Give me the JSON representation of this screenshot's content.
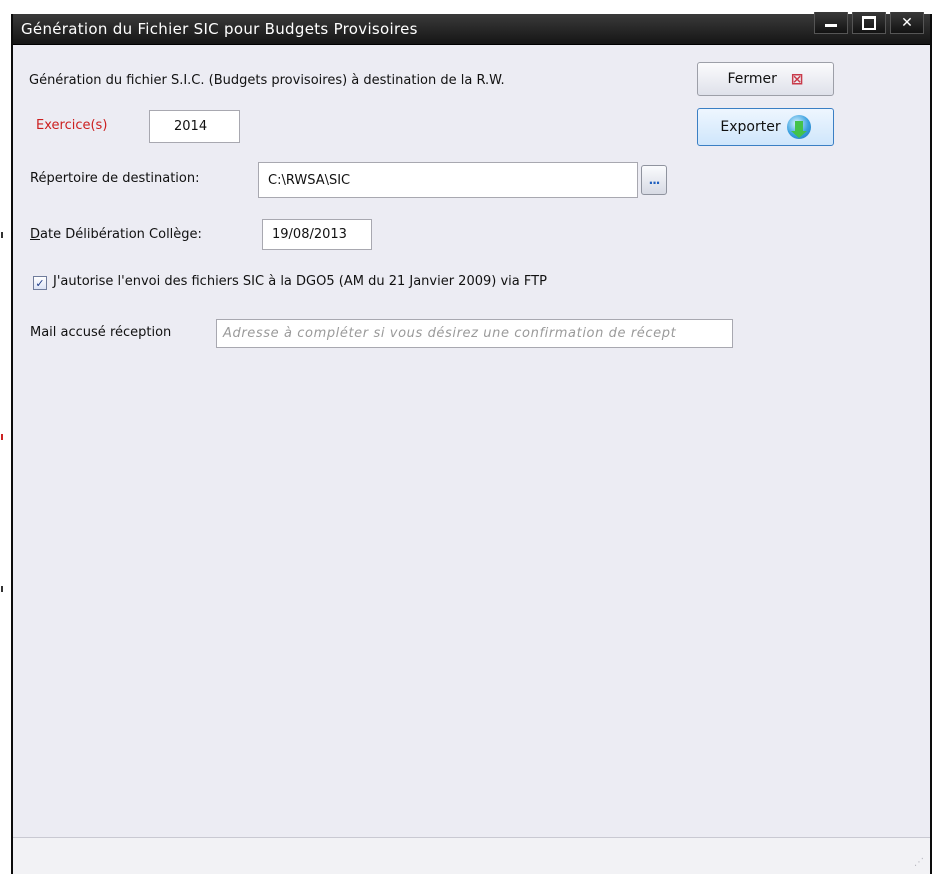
{
  "window": {
    "title": "Génération du Fichier SIC pour Budgets Provisoires",
    "controls": {
      "minimize": "minimize-icon",
      "maximize": "maximize-icon",
      "close": "close-icon"
    }
  },
  "form": {
    "description": "Génération du fichier S.I.C. (Budgets provisoires) à destination de la R.W.",
    "exercise_label": "Exercice(s)",
    "exercise_value": "2014",
    "directory_label": "Répertoire de destination:",
    "directory_value": "C:\\RWSA\\SIC",
    "browse_label": "...",
    "date_label_mnemonic": "D",
    "date_label_rest": "ate Délibération Collège:",
    "date_value": "19/08/2013",
    "ftp_checkbox_label": "J'autorise l'envoi des fichiers SIC à la DGO5 (AM du 21 Janvier 2009) via FTP",
    "ftp_checked": true,
    "mail_label": "Mail accusé réception",
    "mail_placeholder": "Adresse à compléter si vous désirez une confirmation de récept"
  },
  "buttons": {
    "close_label": "Fermer",
    "close_icon": "close-x-icon",
    "export_label": "Exporter",
    "export_icon": "globe-download-icon"
  },
  "colors": {
    "title_bar": "#1c1c1c",
    "window_bg": "#ececf3",
    "required_label": "#cc1f1f",
    "export_border": "#3b7fc4"
  }
}
